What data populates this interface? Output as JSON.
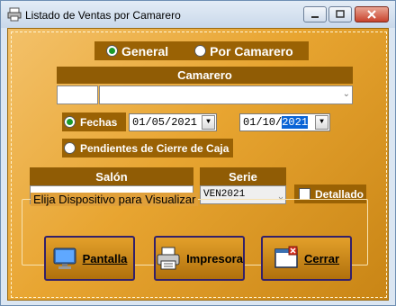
{
  "window": {
    "title": "Listado de Ventas por Camarero"
  },
  "mode": {
    "general_label": "General",
    "camarero_label": "Por Camarero",
    "selected": "General"
  },
  "camarero": {
    "header": "Camarero",
    "code": "",
    "name": ""
  },
  "filters": {
    "fechas_label": "Fechas",
    "date_from": "01/05/2021",
    "date_to_prefix": "01/10/",
    "date_to_year": "2021",
    "pendientes_label": "Pendientes de Cierre de Caja"
  },
  "salon": {
    "header": "Salón",
    "value": ""
  },
  "serie": {
    "header": "Serie",
    "value": "VEN2021"
  },
  "detallado": {
    "label": "Detallado",
    "checked": false
  },
  "output": {
    "group_title": "Elija Dispositivo para Visualizar",
    "pantalla_label": "Pantalla",
    "impresora_label": "Impresora",
    "cerrar_label": "Cerrar"
  },
  "colors": {
    "panel_brown": "#9a6204",
    "client_gold": "#e8a531",
    "selection_blue": "#0a64d6"
  },
  "icons": [
    "printer-icon",
    "minimize-icon",
    "maximize-icon",
    "close-icon",
    "monitor-icon",
    "printer-icon",
    "exit-icon"
  ]
}
